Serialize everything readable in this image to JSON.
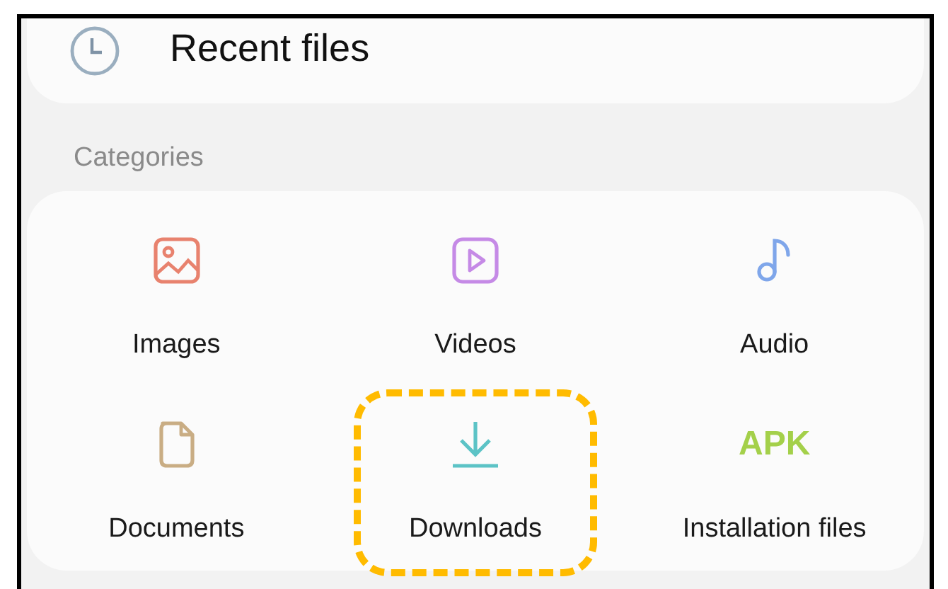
{
  "recent": {
    "label": "Recent files"
  },
  "section_title": "Categories",
  "categories": [
    {
      "label": "Images",
      "kind": "image",
      "color": "#e8826e",
      "highlighted": false
    },
    {
      "label": "Videos",
      "kind": "video",
      "color": "#c58ae6",
      "highlighted": false
    },
    {
      "label": "Audio",
      "kind": "audio",
      "color": "#7fa6ea",
      "highlighted": false
    },
    {
      "label": "Documents",
      "kind": "document",
      "color": "#c9ad84",
      "highlighted": false
    },
    {
      "label": "Downloads",
      "kind": "download",
      "color": "#5cc3c6",
      "highlighted": true
    },
    {
      "label": "Installation files",
      "kind": "apk",
      "icon_text": "APK",
      "color": "#a4d04a",
      "highlighted": false
    }
  ]
}
